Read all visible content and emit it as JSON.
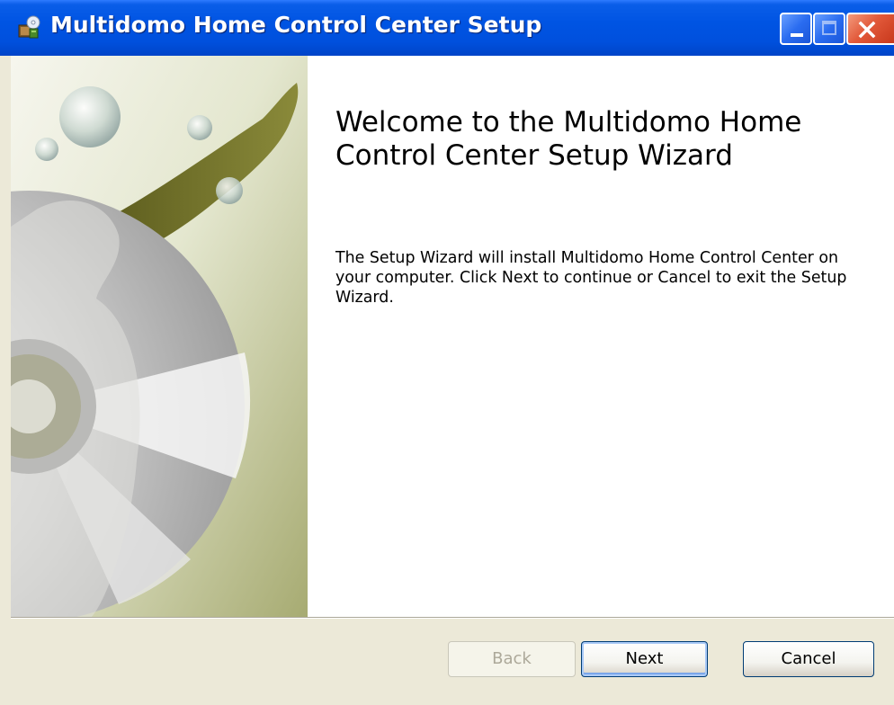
{
  "window": {
    "title": "Multidomo Home Control Center Setup",
    "icon": "installer-package-icon",
    "controls": {
      "minimize": "minimize-icon",
      "maximize": "maximize-icon",
      "close": "close-icon"
    },
    "titlebar_color": "#0054e3",
    "close_color": "#e2593a"
  },
  "welcome": {
    "title": "Welcome to the Multidomo Home Control Center Setup Wizard",
    "body": "The Setup Wizard will install Multidomo Home Control Center on your computer. Click Next to continue or Cancel to exit the Setup Wizard."
  },
  "buttons": {
    "back": {
      "label": "Back",
      "enabled": false
    },
    "next": {
      "label": "Next",
      "enabled": true,
      "default": true
    },
    "cancel": {
      "label": "Cancel",
      "enabled": true
    }
  }
}
